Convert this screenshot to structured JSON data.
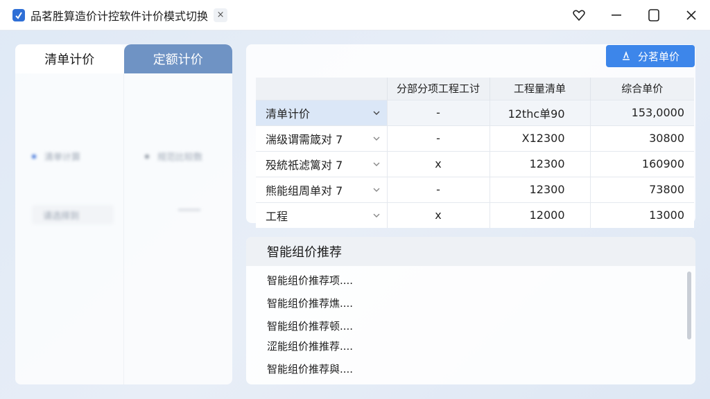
{
  "window": {
    "title": "品茗胜算造价计控软件计价模式切换",
    "close_tab_label": "×"
  },
  "left": {
    "tabs": [
      {
        "label": "清单计价",
        "active": true
      },
      {
        "label": "定额计价",
        "active": false
      }
    ],
    "blurred_items": [
      "清单计算",
      "规范比较数",
      "请选择到"
    ],
    "colors": {
      "tab_inactive": "#6f93c4",
      "dot_blue": "#3a6fd8",
      "dot_gray": "#8a929e"
    }
  },
  "toolbar": {
    "primary_button_label": "分茗单价",
    "primary_color": "#3d86ea"
  },
  "table": {
    "headers": [
      "",
      "分部分项工程工讨",
      "工程量清单",
      "综合单价"
    ],
    "rows": [
      {
        "name": "清单计价",
        "sub": "-",
        "qty": "12thc单90",
        "price": "153,0000"
      },
      {
        "name": "湍级谓需箴对 7",
        "sub": "-",
        "qty": "X12300",
        "price": "30800"
      },
      {
        "name": "殁統祇滤篱对 7",
        "sub": "x",
        "qty": "12300",
        "price": "160900"
      },
      {
        "name": "熊能组周单对 7",
        "sub": "-",
        "qty": "12300",
        "price": "73800"
      },
      {
        "name": "工程",
        "sub": "x",
        "qty": "12000",
        "price": "13000"
      }
    ]
  },
  "recommend": {
    "title": "智能组价推荐",
    "items": [
      "智能组价推荐项....",
      "智能组价推荐燋....",
      "智能组价推荐顿....",
      "涩能组价推推荐....",
      "智能组价推荐與...."
    ]
  }
}
